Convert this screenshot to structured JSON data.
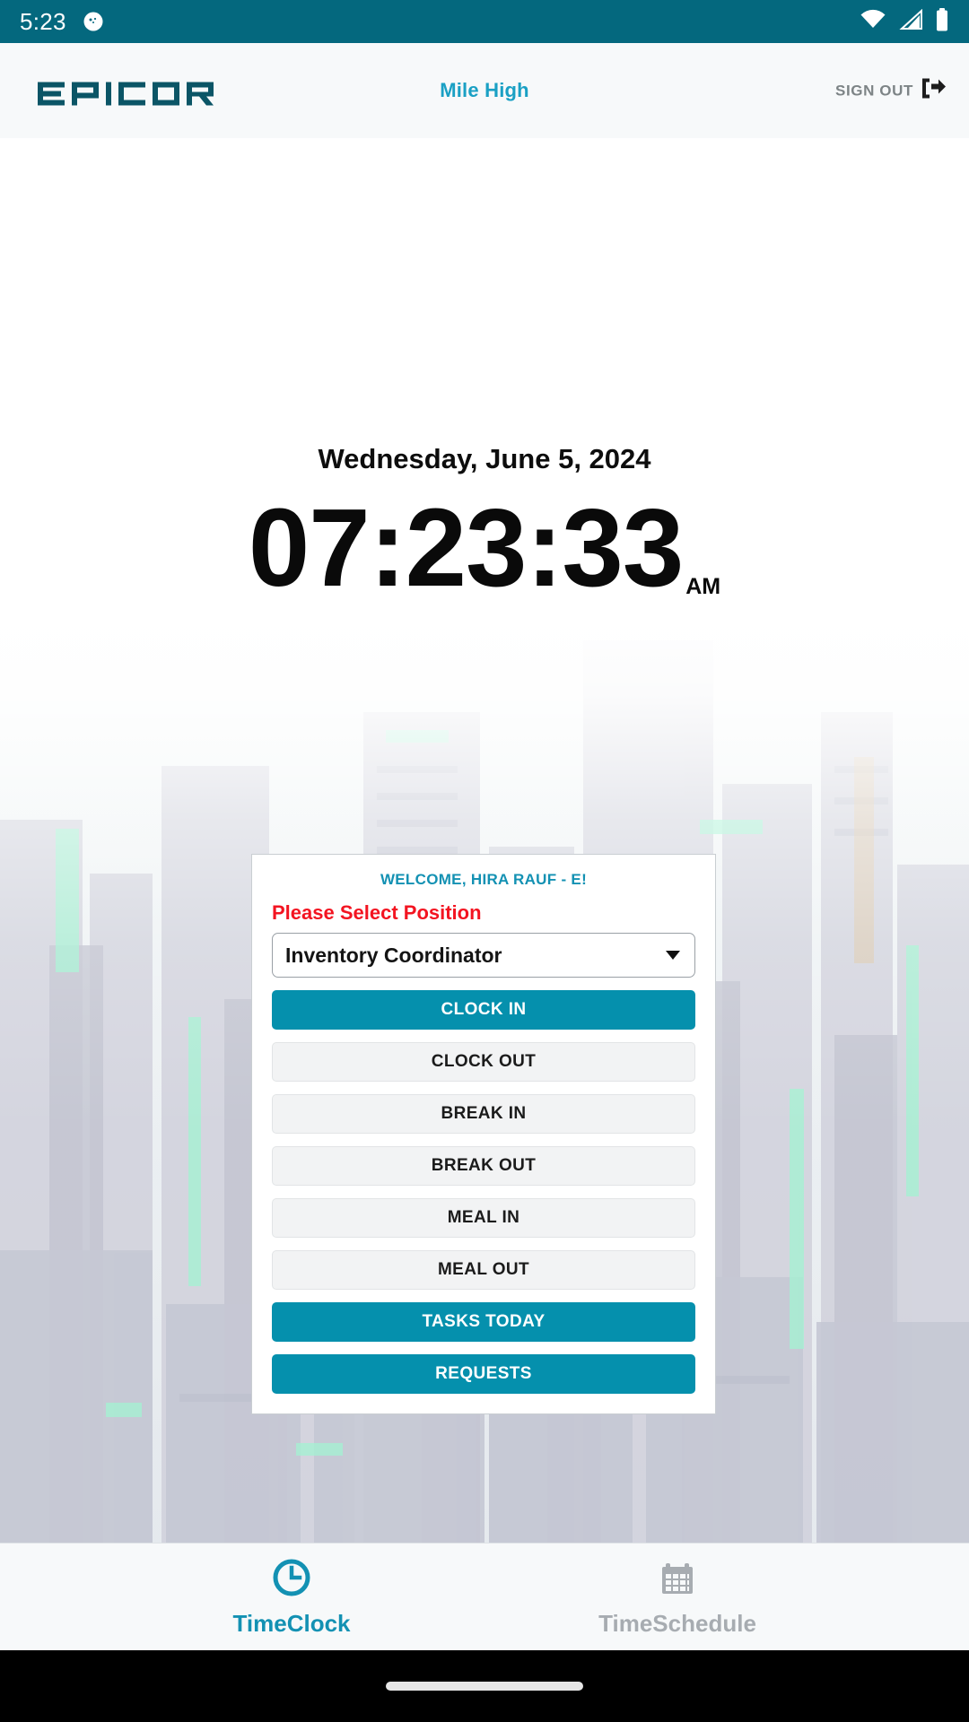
{
  "status_bar": {
    "time": "5:23",
    "icons": [
      "notification-circle-icon",
      "wifi-icon",
      "cellular-signal-icon",
      "battery-icon"
    ],
    "background_color": "#04687E"
  },
  "header": {
    "logo_text": "EPICOR",
    "site_name": "Mile High",
    "sign_out_label": "SIGN OUT",
    "sign_out_icon": "logout-arrow-icon",
    "background_color": "#f7f9fa",
    "site_name_color": "#1AA0C4"
  },
  "clock": {
    "date": "Wednesday, June 5, 2024",
    "time": "07:23:33",
    "meridiem": "AM"
  },
  "card": {
    "welcome": "WELCOME, HIRA RAUF - E!",
    "welcome_color": "#1391B3",
    "select_label": "Please Select Position",
    "select_label_color": "#f31421",
    "position_value": "Inventory Coordinator",
    "dropdown_icon": "chevron-down-icon",
    "buttons": [
      {
        "label": "CLOCK IN",
        "style": "primary"
      },
      {
        "label": "CLOCK OUT",
        "style": "secondary"
      },
      {
        "label": "BREAK IN",
        "style": "secondary"
      },
      {
        "label": "BREAK OUT",
        "style": "secondary"
      },
      {
        "label": "MEAL IN",
        "style": "secondary"
      },
      {
        "label": "MEAL OUT",
        "style": "secondary"
      },
      {
        "label": "TASKS TODAY",
        "style": "primary"
      },
      {
        "label": "REQUESTS",
        "style": "primary"
      }
    ],
    "primary_color": "#0590AD",
    "secondary_color": "#f2f3f4"
  },
  "bottom_nav": {
    "items": [
      {
        "label": "TimeClock",
        "icon": "clock-icon",
        "active": true
      },
      {
        "label": "TimeSchedule",
        "icon": "calendar-icon",
        "active": false
      }
    ],
    "active_color": "#1391B3",
    "inactive_color": "#a7acb1"
  }
}
